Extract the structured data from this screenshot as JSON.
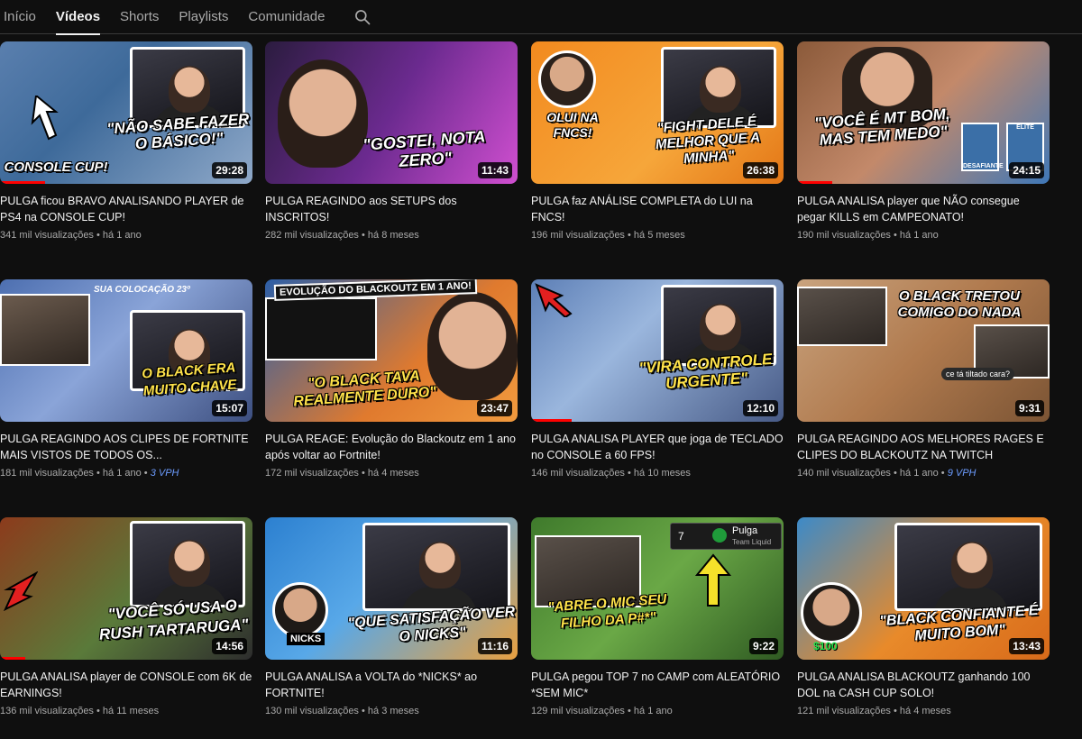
{
  "tabs": [
    {
      "label": "Início"
    },
    {
      "label": "Vídeos"
    },
    {
      "label": "Shorts"
    },
    {
      "label": "Playlists"
    },
    {
      "label": "Comunidade"
    }
  ],
  "search": {
    "icon": "search-icon"
  },
  "colors": {
    "background": "#0f0f0f",
    "accent_progress": "#ff0000",
    "vph": "#6c9cff"
  },
  "videos": [
    {
      "title": "PULGA ficou BRAVO ANALISANDO PLAYER de PS4 na CONSOLE CUP!",
      "views": "341 mil visualizações",
      "age": "há 1 ano",
      "duration": "29:28",
      "thumb_texts": [
        "\"NÃO SABE FAZER O BÁSICO!\"",
        "CONSOLE CUP!"
      ]
    },
    {
      "title": "PULGA REAGINDO aos SETUPS dos INSCRITOS!",
      "views": "282 mil visualizações",
      "age": "há 8 meses",
      "duration": "11:43",
      "thumb_texts": [
        "\"GOSTEI, NOTA ZERO\""
      ]
    },
    {
      "title": "PULGA faz ANÁLISE COMPLETA do LUI na FNCS!",
      "views": "196 mil visualizações",
      "age": "há 5 meses",
      "duration": "26:38",
      "thumb_texts": [
        "OLUI NA FNCS!",
        "\"FIGHT DELE É MELHOR QUE A MINHA\""
      ]
    },
    {
      "title": "PULGA ANALISA player que NÃO consegue pegar KILLS em CAMPEONATO!",
      "views": "190 mil visualizações",
      "age": "há 1 ano",
      "duration": "24:15",
      "thumb_texts": [
        "\"VOCÊ É MT BOM, MAS TEM MEDO\"",
        "DESAFIANTE",
        "ELITE"
      ]
    },
    {
      "title": "PULGA REAGINDO AOS CLIPES DE FORTNITE MAIS VISTOS DE TODOS OS...",
      "views": "181 mil visualizações",
      "age": "há 1 ano",
      "vph": "3 VPH",
      "duration": "15:07",
      "thumb_texts": [
        "O BLACK ERA MUITO CHAVE",
        "SUA COLOCAÇÃO 23º"
      ]
    },
    {
      "title": "PULGA REAGE: Evolução do Blackoutz em 1 ano após voltar ao Fortnite!",
      "views": "172 mil visualizações",
      "age": "há 4 meses",
      "duration": "23:47",
      "thumb_texts": [
        "EVOLUÇÃO DO BLACKOUTZ EM 1 ANO!",
        "\"O BLACK TAVA REALMENTE DURO\""
      ]
    },
    {
      "title": "PULGA ANALISA PLAYER que joga de TECLADO no CONSOLE a 60 FPS!",
      "views": "146 mil visualizações",
      "age": "há 10 meses",
      "duration": "12:10",
      "thumb_texts": [
        "\"VIRA CONTROLE URGENTE\""
      ]
    },
    {
      "title": "PULGA REAGINDO AOS MELHORES RAGES E CLIPES DO BLACKOUTZ NA TWITCH",
      "views": "140 mil visualizações",
      "age": "há 1 ano",
      "vph": "9 VPH",
      "duration": "9:31",
      "thumb_texts": [
        "O BLACK TRETOU COMIGO DO NADA",
        "ce tá tiltado cara?"
      ]
    },
    {
      "title": "PULGA ANALISA player de CONSOLE com 6K de EARNINGS!",
      "views": "136 mil visualizações",
      "age": "há 11 meses",
      "duration": "14:56",
      "thumb_texts": [
        "\"VOCÊ SÓ USA O RUSH TARTARUGA\""
      ]
    },
    {
      "title": "PULGA ANALISA a VOLTA do *NICKS* ao FORTNITE!",
      "views": "130 mil visualizações",
      "age": "há 3 meses",
      "duration": "11:16",
      "thumb_texts": [
        "\"QUE SATISFAÇÃO VER O NICKS\"",
        "NICKS"
      ]
    },
    {
      "title": "PULGA pegou TOP 7 no CAMP com ALEATÓRIO *SEM MIC*",
      "views": "129 mil visualizações",
      "age": "há 1 ano",
      "duration": "9:22",
      "thumb_texts": [
        "\"ABRE O MIC SEU FILHO DA P#*\"",
        "7",
        "Pulga",
        "Team Liquid"
      ]
    },
    {
      "title": "PULGA ANALISA BLACKOUTZ ganhando 100 DOL na CASH CUP SOLO!",
      "views": "121 mil visualizações",
      "age": "há 4 meses",
      "duration": "13:43",
      "thumb_texts": [
        "\"BLACK CONFIANTE É MUITO BOM\"",
        "$100"
      ]
    }
  ]
}
